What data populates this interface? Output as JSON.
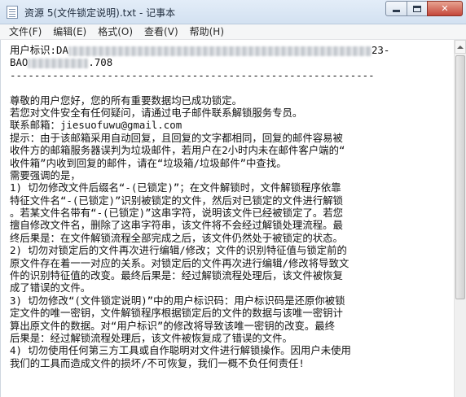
{
  "window": {
    "title": "资源 5(文件锁定说明).txt - 记事本",
    "min_glyph": "",
    "max_glyph": "",
    "close_glyph": "✕"
  },
  "menu": {
    "items": [
      "文件(F)",
      "编辑(E)",
      "格式(O)",
      "查看(V)",
      "帮助(H)"
    ]
  },
  "document": {
    "id_line1_prefix": "用户标识:DA",
    "id_line1_suffix": "23-",
    "id_line2_prefix": "BAO",
    "id_line2_suffix": ".708",
    "separator": "------------------------------------------------------------",
    "lines": [
      "尊敬的用户您好，您的所有重要数据均已成功锁定。",
      "若您对文件安全有任何疑问，请通过电子邮件联系解锁服务专员。",
      "联系邮箱：jiesuofuwu@gmail.com",
      "提示：由于该邮箱采用自动回复，且回复的文字都相同，回复的邮件容易被",
      "收件方的邮箱服务器误判为垃圾邮件，若用户在2小时内未在邮件客户端的“",
      "收件箱”内收到回复的邮件，请在“垃圾箱/垃圾邮件”中查找。",
      "需要强调的是，",
      "1) 切勿修改文件后缀名“-(已锁定)”；在文件解锁时，文件解锁程序依靠",
      "特征文件名“-(已锁定)”识别被锁定的文件，然后对已锁定的文件进行解锁",
      "。若某文件名带有“-(已锁定)”这串字符，说明该文件已经被锁定了。若您",
      "擅自修改文件名，删除了这串字符串，该文件将不会经过解锁处理流程。最",
      "终后果是：在文件解锁流程全部完成之后，该文件仍然处于被锁定的状态。",
      "2) 切勿对锁定后的文件再次进行编辑/修改；文件的识别特征值与锁定前的",
      "原文件存在着一一对应的关系。对锁定后的文件再次进行编辑/修改将导致文",
      "件的识别特征值的改变。最终后果是：经过解锁流程处理后，该文件被恢复",
      "成了错误的文件。",
      "3) 切勿修改“(文件锁定说明)”中的用户标识码：用户标识码是还原你被锁",
      "定文件的唯一密钥，文件解锁程序根据锁定后的文件的数据与该唯一密钥计",
      "算出原文件的数据。对“用户标识”的修改将导致该唯一密钥的改变。最终",
      "后果是：经过解锁流程处理后，该文件被恢复成了错误的文件。",
      "4) 切勿使用任何第三方工具或自作聪明对文件进行解锁操作。因用户未使用",
      "我们的工具而造成文件的损坏/不可恢复，我们一概不负任何责任!"
    ]
  }
}
